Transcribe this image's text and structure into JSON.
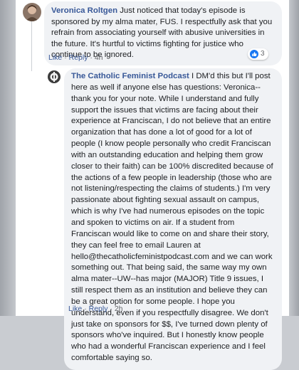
{
  "comment1": {
    "author": "Veronica Roltgen",
    "text": "Just noticed that today's episode is sponsored by my alma mater, FUS. I respectfully ask that you refrain from associating yourself with abusive universities in the future. It's hurtful to victims fighting for justice who continue to be ignored.",
    "like_label": "Like",
    "reply_label": "Reply",
    "time": "4h",
    "reaction_count": "3"
  },
  "reply1": {
    "author": "The Catholic Feminist Podcast",
    "text": "I DM'd this but I'll post here as well if anyone else has questions: Veronica--thank you for your note. While I understand and fully support the issues that victims are facing about their experience at Franciscan, I do not believe that an entire organization that has done a lot of good for a lot of people (I know people personally who credit Franciscan with an outstanding education and helping them grow closer to their faith) can be 100% discredited because of the actions of a few people in leadership (those who are not listening/respecting the claims of students.) I'm very passionate about fighting sexual assault on campus, which is why I've had numerous episodes on the topic and spoken to victims on air. If a student from Franciscan would like to come on and share their story, they can feel free to email Lauren at hello@thecatholicfeministpodcast.com and we can work something out. That being said, the same way my own alma mater--UW--has major (MAJOR) Title 9 issues, I still respect them as an institution and believe they can be a great option for some people. I hope you understand, even if you respectfully disagree. We don't just take on sponsors for $$, I've turned down plenty of sponsors who've inquired. But I honestly know people who had a wonderful Franciscan experience and I feel comfortable saying so.",
    "like_label": "Like",
    "reply_label": "Reply",
    "time": "2h"
  },
  "colors": {
    "link": "#385898",
    "bubble": "#f0f2f5",
    "like_blue": "#1877f2"
  }
}
